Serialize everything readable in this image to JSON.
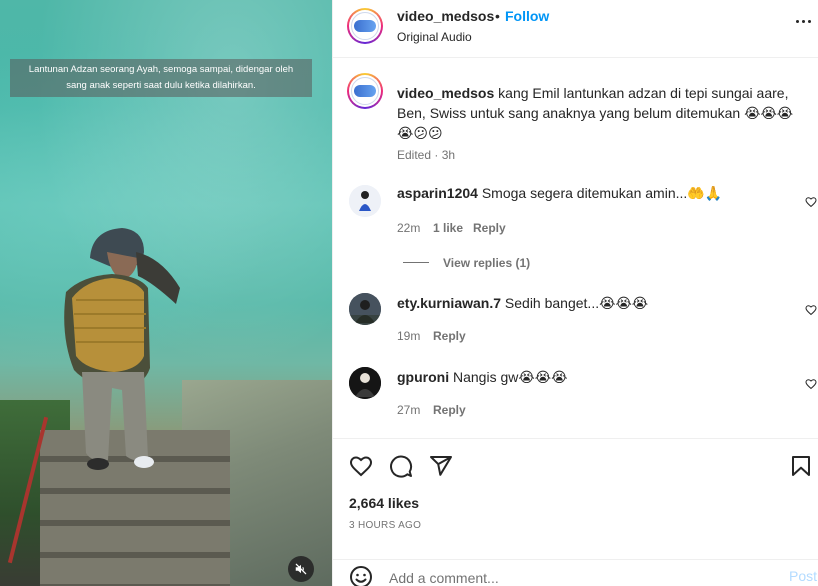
{
  "video": {
    "caption_line1": "Lantunan Adzan seorang Ayah, semoga sampai, didengar oleh",
    "caption_line2": "sang anak seperti saat dulu ketika dilahirkan.",
    "mute_icon": "speaker-muted-icon"
  },
  "header": {
    "username": "video_medsos",
    "separator": "•",
    "follow_label": "Follow",
    "audio": "Original Audio",
    "more_icon": "more-options-icon"
  },
  "caption": {
    "username": "video_medsos",
    "text": "kang Emil lantunkan adzan di tepi sungai aare, Ben, Swiss untuk sang anaknya yang belum ditemukan 😭😭😭 😭😕😕",
    "meta": "Edited · 3h"
  },
  "comments": [
    {
      "username": "asparin1204",
      "text": "Smoga segera ditemukan amin...🤲🙏",
      "time": "22m",
      "likes": "1 like",
      "reply": "Reply",
      "view_replies": "View replies (1)"
    },
    {
      "username": "ety.kurniawan.7",
      "text": "Sedih banget...😭😭😭",
      "time": "19m",
      "reply": "Reply"
    },
    {
      "username": "gpuroni",
      "text": "Nangis gw😭😭😭",
      "time": "27m",
      "reply": "Reply"
    }
  ],
  "actions": {
    "like_icon": "heart-icon",
    "comment_icon": "comment-icon",
    "share_icon": "share-icon",
    "save_icon": "bookmark-icon",
    "likes": "2,664 likes",
    "time_ago": "3 HOURS AGO"
  },
  "add_comment": {
    "placeholder": "Add a comment...",
    "post_label": "Post",
    "emoji_icon": "emoji-icon"
  },
  "colors": {
    "accent": "#0095f6",
    "text": "#262626",
    "muted": "#737373",
    "border": "#efefef",
    "post_disabled": "#b3dbff"
  }
}
